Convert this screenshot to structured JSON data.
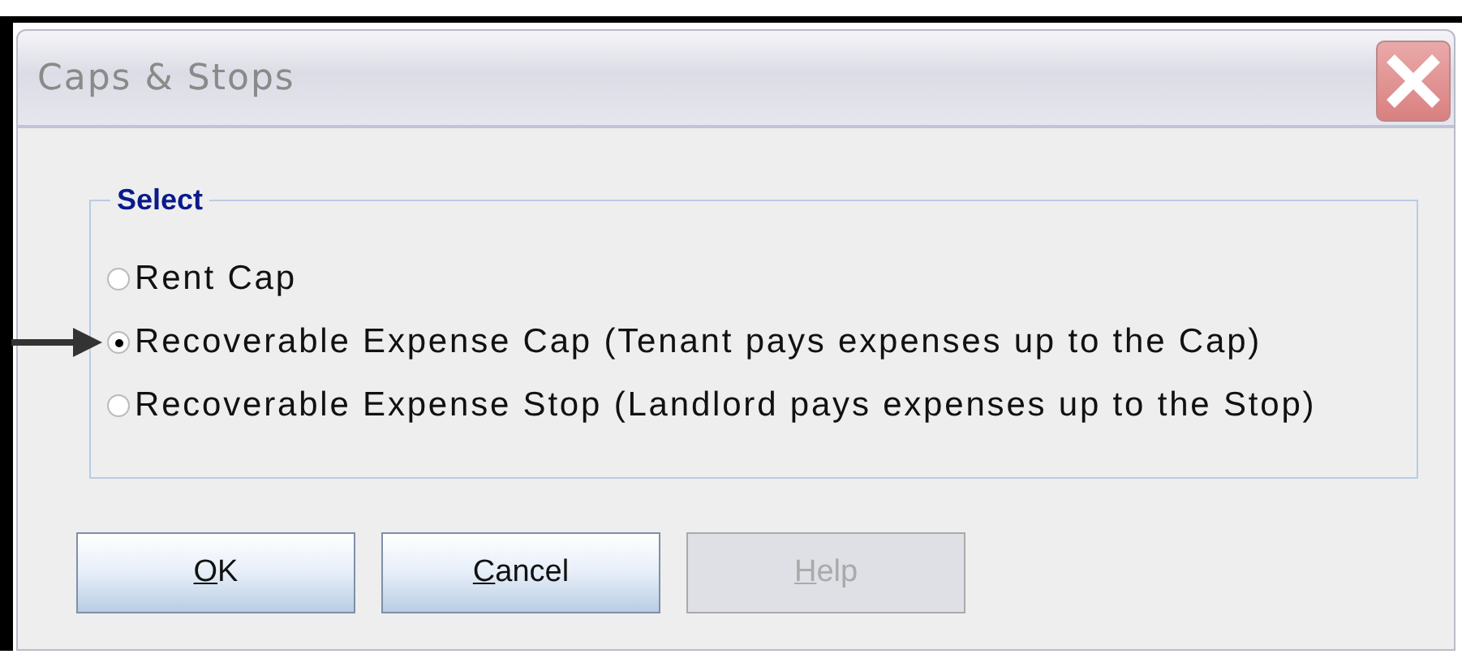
{
  "window": {
    "title": "Caps & Stops"
  },
  "group": {
    "title": "Select",
    "options": [
      {
        "label": "Rent Cap",
        "selected": false,
        "pointer_arrow": false
      },
      {
        "label": "Recoverable Expense Cap (Tenant pays expenses up to the Cap)",
        "selected": true,
        "pointer_arrow": true
      },
      {
        "label": "Recoverable Expense Stop (Landlord pays expenses up to the Stop)",
        "selected": false,
        "pointer_arrow": false
      }
    ]
  },
  "buttons": [
    {
      "label": "OK",
      "disabled": false,
      "mnemonic_underlined": true
    },
    {
      "label": "Cancel",
      "disabled": false,
      "mnemonic_underlined": true
    },
    {
      "label": "Help",
      "disabled": true,
      "mnemonic_underlined": true
    }
  ]
}
